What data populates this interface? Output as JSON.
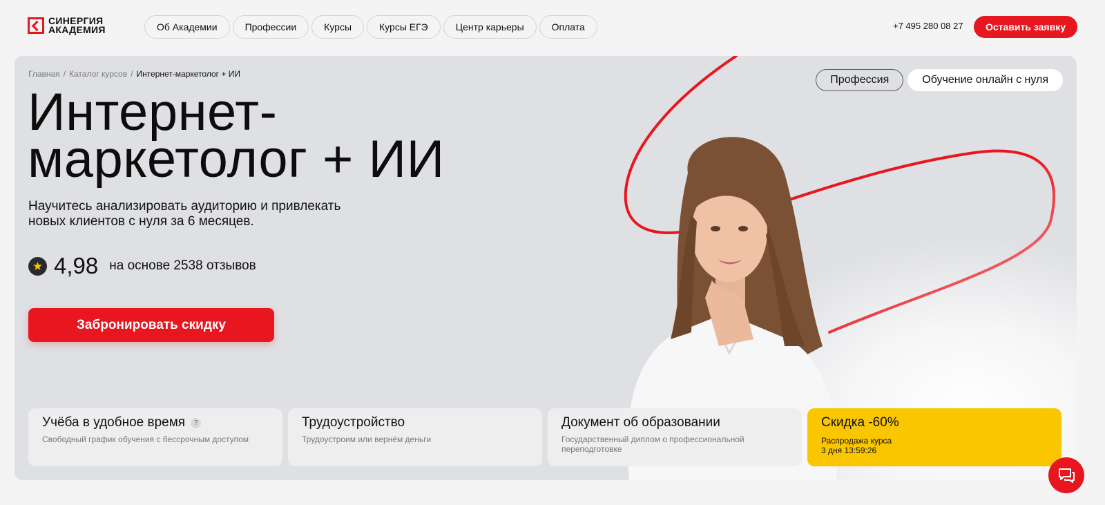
{
  "header": {
    "logo": {
      "line1": "СИНЕРГИЯ",
      "line2": "АКАДЕМИЯ"
    },
    "nav": [
      {
        "label": "Об Академии"
      },
      {
        "label": "Профессии"
      },
      {
        "label": "Курсы"
      },
      {
        "label": "Курсы ЕГЭ"
      },
      {
        "label": "Центр карьеры"
      },
      {
        "label": "Оплата"
      }
    ],
    "phone": "+7 495 280 08 27",
    "cta_label": "Оставить заявку"
  },
  "hero": {
    "breadcrumb": [
      {
        "label": "Главная"
      },
      {
        "label": "Каталог курсов"
      },
      {
        "label": "Интернет-маркетолог + ИИ"
      }
    ],
    "breadcrumb_separator": "/",
    "tags": [
      {
        "label": "Профессия"
      },
      {
        "label": "Обучение онлайн с нуля"
      }
    ],
    "title_line1": "Интернет-",
    "title_line2": "маркетолог + ИИ",
    "subtitle_line1": "Научитесь анализировать аудиторию и привлекать",
    "subtitle_line2": "новых клиентов с нуля за 6 месяцев.",
    "rating_value": "4,98",
    "rating_text": "на основе 2538 отзывов",
    "cta_label": "Забронировать скидку"
  },
  "cards": [
    {
      "title": "Учёба в удобное время",
      "help": "?",
      "desc": "Свободный график обучения с бессрочным доступом"
    },
    {
      "title": "Трудоустройство",
      "desc": "Трудоустроим или вернём деньги"
    },
    {
      "title": "Документ об образовании",
      "desc": "Государственный диплом о профессиональной переподготовке"
    },
    {
      "title": "Скидка -60%",
      "desc_line1": "Распродажа курса",
      "desc_line2": "3 дня 13:59:26"
    }
  ],
  "colors": {
    "accent": "#e8161e",
    "sale": "#f9c600",
    "hero_bg": "#dfe0e3"
  },
  "icons": {
    "star": "star-icon",
    "chat": "chat-icon",
    "help": "help-icon"
  }
}
